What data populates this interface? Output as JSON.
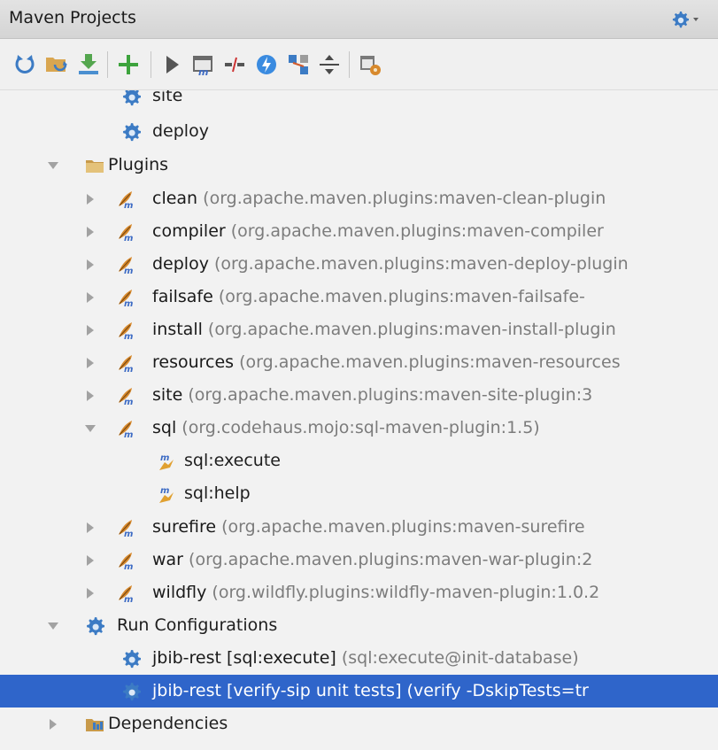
{
  "header": {
    "title": "Maven Projects"
  },
  "toolbar": {
    "buttons": [
      "reimport-icon",
      "generate-sources-icon",
      "download-icon",
      "add-icon",
      "run-icon",
      "execute-goal-icon",
      "toggle-offline-icon",
      "skip-tests-icon",
      "show-dependencies-icon",
      "collapse-all-icon",
      "settings-icon"
    ]
  },
  "tree": {
    "lifecycle": {
      "site": "site",
      "deploy": "deploy"
    },
    "plugins": {
      "label": "Plugins",
      "items": [
        {
          "name": "clean",
          "coord": "(org.apache.maven.plugins:maven-clean-plugin"
        },
        {
          "name": "compiler",
          "coord": "(org.apache.maven.plugins:maven-compiler"
        },
        {
          "name": "deploy",
          "coord": "(org.apache.maven.plugins:maven-deploy-plugin"
        },
        {
          "name": "failsafe",
          "coord": "(org.apache.maven.plugins:maven-failsafe-"
        },
        {
          "name": "install",
          "coord": "(org.apache.maven.plugins:maven-install-plugin"
        },
        {
          "name": "resources",
          "coord": "(org.apache.maven.plugins:maven-resources"
        },
        {
          "name": "site",
          "coord": "(org.apache.maven.plugins:maven-site-plugin:3"
        },
        {
          "name": "sql",
          "coord": "(org.codehaus.mojo:sql-maven-plugin:1.5)"
        },
        {
          "name": "surefire",
          "coord": "(org.apache.maven.plugins:maven-surefire"
        },
        {
          "name": "war",
          "coord": "(org.apache.maven.plugins:maven-war-plugin:2"
        },
        {
          "name": "wildfly",
          "coord": "(org.wildfly.plugins:wildfly-maven-plugin:1.0.2"
        }
      ],
      "sql_goals": [
        "sql:execute",
        "sql:help"
      ]
    },
    "run_configurations": {
      "label": "Run Configurations",
      "items": [
        {
          "name": "jbib-rest [sql:execute]",
          "detail": "(sql:execute@init-database)"
        },
        {
          "name": "jbib-rest [verify-sip unit tests]",
          "detail": "(verify -DskipTests=tr"
        }
      ]
    },
    "dependencies": {
      "label": "Dependencies"
    }
  },
  "colors": {
    "selection": "#2f65ca",
    "background": "#f2f2f2",
    "secondary_text": "#7c7c7c"
  }
}
